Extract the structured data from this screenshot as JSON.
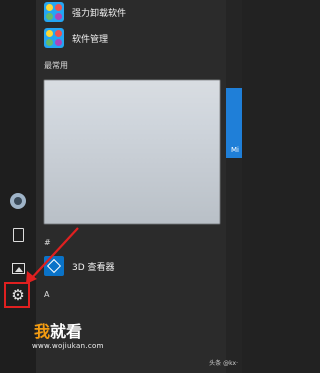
{
  "apps_top": [
    {
      "label": "强力卸载软件",
      "icon": "colorful-app-icon"
    },
    {
      "label": "软件管理",
      "icon": "colorful-app-icon"
    }
  ],
  "recent_heading": "最常用",
  "hash_heading": "#",
  "app_3d": {
    "label": "3D 查看器",
    "icon": "3d-cube-icon"
  },
  "letter_heading": "A",
  "tile_text": "Mi",
  "watermark": {
    "title_part1": "我",
    "title_part2": "就看",
    "url": "www.wojiukan.com",
    "credit": "头条 @kx·"
  },
  "colors": {
    "highlight": "#e02020",
    "arrow": "#e02020",
    "tile": "#1f7fd8",
    "watermark_accent": "#f39c12"
  }
}
